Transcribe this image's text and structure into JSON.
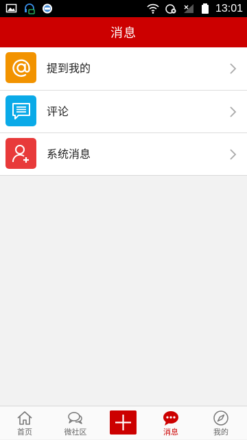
{
  "status_bar": {
    "time": "13:01",
    "left_icons": [
      "image-icon",
      "headset-icon",
      "badge-icon"
    ],
    "right_icons": [
      "wifi-icon",
      "alarm-icon",
      "signal-icon",
      "battery-icon"
    ]
  },
  "header": {
    "title": "消息"
  },
  "messages": {
    "items": [
      {
        "label": "提到我的",
        "icon": "at-icon",
        "color": "#f29300"
      },
      {
        "label": "评论",
        "icon": "comment-icon",
        "color": "#0aaae8"
      },
      {
        "label": "系统消息",
        "icon": "add-user-icon",
        "color": "#e83a3a"
      }
    ]
  },
  "bottom_nav": {
    "items": [
      {
        "label": "首页",
        "icon": "home-icon"
      },
      {
        "label": "微社区",
        "icon": "chat-bubbles-icon"
      },
      {
        "label": "",
        "icon": "plus-icon"
      },
      {
        "label": "消息",
        "icon": "message-icon",
        "active": true
      },
      {
        "label": "我的",
        "icon": "compass-icon"
      }
    ]
  },
  "colors": {
    "brand_red": "#cc0000",
    "background": "#f2f2f2",
    "text": "#222222",
    "nav_text": "#666666"
  }
}
